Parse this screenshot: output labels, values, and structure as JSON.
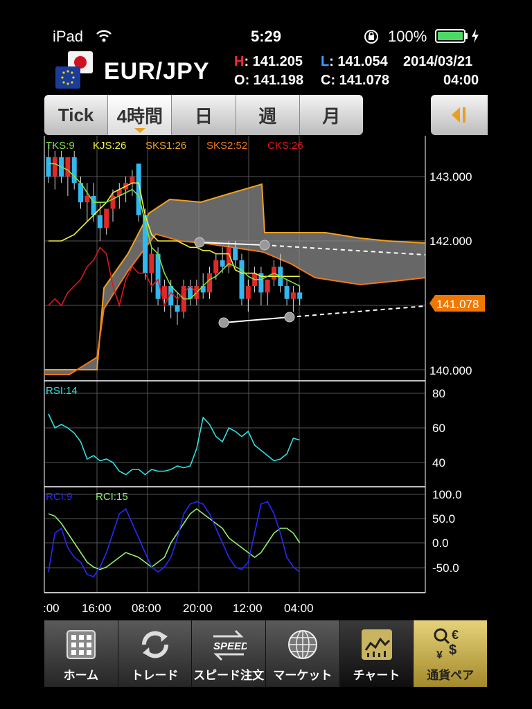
{
  "status_bar": {
    "device": "iPad",
    "time": "5:29",
    "battery": "100%"
  },
  "header": {
    "pair": "EUR/JPY",
    "high_label": "H",
    "high_value": ": 141.205",
    "low_label": "L",
    "low_value": ": 141.054",
    "open_label": "O",
    "open_value": ": 141.198",
    "close_label": "C",
    "close_value": ": 141.078",
    "date": "2014/03/21",
    "time": "04:00"
  },
  "tabs": [
    {
      "label": "Tick",
      "active": false
    },
    {
      "label": "4時間",
      "active": true
    },
    {
      "label": "日",
      "active": false
    },
    {
      "label": "週",
      "active": false
    },
    {
      "label": "月",
      "active": false
    }
  ],
  "indicators": {
    "tks": "TKS:9",
    "kjs": "KJS:26",
    "sks1": "SKS1:26",
    "sks2": "SKS2:52",
    "cks": "CKS:26",
    "rsi": "RSI:14",
    "rci9": "RCI:9",
    "rci15": "RCI:15"
  },
  "colors": {
    "tks": "#80e040",
    "kjs": "#f0f040",
    "sks1": "#f0a020",
    "sks2": "#f07818",
    "cks": "#e01818",
    "rsi": "#30e0e0",
    "rci9": "#2828ff",
    "rci15": "#90f070",
    "bull": "#e02828",
    "bear": "#30b8f0",
    "price_tag": "#f07800"
  },
  "price_axis": [
    "143.000",
    "142.000",
    "140.000"
  ],
  "current_price": "141.078",
  "rsi_axis": [
    "80",
    "60",
    "40"
  ],
  "rci_axis": [
    "100.0",
    "50.0",
    "0.0",
    "-50.0"
  ],
  "time_axis": [
    ":00",
    "16:00",
    "08:00",
    "20:00",
    "12:00",
    "04:00"
  ],
  "nav": [
    {
      "label": "ホーム",
      "icon": "grid-icon"
    },
    {
      "label": "トレード",
      "icon": "refresh-icon"
    },
    {
      "label": "スピード注文",
      "icon": "speed-icon"
    },
    {
      "label": "マーケット",
      "icon": "globe-icon"
    },
    {
      "label": "チャート",
      "icon": "chart-icon",
      "active": true
    },
    {
      "label": "通貨ペア",
      "icon": "currency-icon"
    }
  ],
  "chart_data": {
    "type": "candlestick",
    "ylim": [
      139.9,
      143.3
    ],
    "grid": true,
    "x_ticks": [
      ":00",
      "16:00",
      "08:00",
      "20:00",
      "12:00",
      "04:00"
    ],
    "candles": [
      [
        143.3,
        143.5,
        142.9,
        143.0
      ],
      [
        143.0,
        143.4,
        142.8,
        143.3
      ],
      [
        143.3,
        143.4,
        142.9,
        143.0
      ],
      [
        143.0,
        143.3,
        142.7,
        143.3
      ],
      [
        143.3,
        143.4,
        142.8,
        142.9
      ],
      [
        142.9,
        143.0,
        142.5,
        142.6
      ],
      [
        142.6,
        142.9,
        142.3,
        142.7
      ],
      [
        142.7,
        142.9,
        142.3,
        142.4
      ],
      [
        142.4,
        142.6,
        142.0,
        142.2
      ],
      [
        142.2,
        142.5,
        142.1,
        142.5
      ],
      [
        142.5,
        142.8,
        142.3,
        142.7
      ],
      [
        142.7,
        142.9,
        142.5,
        142.8
      ],
      [
        142.8,
        143.0,
        142.6,
        142.9
      ],
      [
        142.9,
        143.1,
        142.7,
        143.0
      ],
      [
        143.2,
        143.2,
        142.3,
        142.4
      ],
      [
        142.4,
        142.5,
        141.4,
        141.5
      ],
      [
        141.5,
        141.9,
        141.2,
        141.8
      ],
      [
        141.8,
        141.9,
        141.0,
        141.1
      ],
      [
        141.1,
        141.4,
        140.9,
        141.3
      ],
      [
        141.3,
        141.4,
        140.8,
        141.0
      ],
      [
        141.0,
        141.2,
        140.7,
        140.9
      ],
      [
        140.9,
        141.4,
        140.8,
        141.3
      ],
      [
        141.3,
        141.4,
        141.0,
        141.1
      ],
      [
        141.1,
        141.4,
        141.0,
        141.3
      ],
      [
        141.3,
        141.5,
        141.1,
        141.2
      ],
      [
        141.2,
        141.6,
        141.1,
        141.5
      ],
      [
        141.5,
        141.8,
        141.4,
        141.7
      ],
      [
        141.7,
        141.9,
        141.5,
        141.6
      ],
      [
        141.6,
        142.0,
        141.5,
        141.9
      ],
      [
        141.9,
        142.0,
        141.6,
        141.7
      ],
      [
        141.7,
        141.8,
        141.0,
        141.1
      ],
      [
        141.1,
        141.4,
        140.9,
        141.3
      ],
      [
        141.3,
        141.6,
        141.2,
        141.5
      ],
      [
        141.5,
        141.6,
        141.0,
        141.2
      ],
      [
        141.2,
        141.4,
        141.0,
        141.4
      ],
      [
        141.4,
        141.7,
        141.3,
        141.6
      ],
      [
        141.6,
        141.8,
        141.2,
        141.3
      ],
      [
        141.3,
        141.4,
        141.0,
        141.1
      ],
      [
        141.1,
        141.3,
        140.9,
        141.2
      ],
      [
        141.2,
        141.3,
        141.0,
        141.1
      ]
    ],
    "tks": [
      143.2,
      143.2,
      143.15,
      143.1,
      143.0,
      142.9,
      142.75,
      142.6,
      142.6,
      142.6,
      142.65,
      142.7,
      142.75,
      142.8,
      142.7,
      142.3,
      141.9,
      141.8,
      141.5,
      141.3,
      141.2,
      141.1,
      141.1,
      141.2,
      141.3,
      141.4,
      141.45,
      141.55,
      141.65,
      141.6,
      141.55,
      141.45,
      141.4,
      141.4,
      141.45,
      141.5,
      141.45,
      141.4,
      141.35,
      141.3
    ],
    "kjs": [
      142.0,
      142.0,
      142.0,
      142.05,
      142.1,
      142.2,
      142.3,
      142.4,
      142.5,
      142.6,
      142.75,
      142.8,
      142.85,
      142.9,
      142.9,
      142.4,
      142.1,
      142.0,
      142.0,
      142.0,
      142.0,
      141.95,
      141.9,
      141.9,
      141.85,
      141.85,
      141.8,
      141.8,
      141.8,
      141.55,
      141.5,
      141.5,
      141.5,
      141.45,
      141.45,
      141.45,
      141.45,
      141.45,
      141.45,
      141.45
    ],
    "cks": [
      141.0,
      141.1,
      141.0,
      141.2,
      141.3,
      141.4,
      141.6,
      141.7,
      141.9,
      141.8,
      141.3,
      141.0,
      141.4,
      141.6,
      141.5,
      141.5,
      141.3,
      141.4,
      141.0,
      141.2,
      141.1,
      141.2,
      141.3,
      141.2
    ],
    "rsi": [
      68,
      60,
      62,
      60,
      57,
      52,
      42,
      44,
      41,
      42,
      40,
      35,
      33,
      36,
      36,
      33,
      36,
      35,
      35,
      36,
      38,
      37,
      38,
      48,
      66,
      62,
      55,
      52,
      60,
      58,
      55,
      58,
      50,
      47,
      44,
      41,
      42,
      45,
      54,
      53
    ],
    "rci9": [
      -60,
      20,
      30,
      -10,
      -30,
      -40,
      -65,
      -70,
      -50,
      -20,
      20,
      60,
      70,
      40,
      10,
      -20,
      -50,
      -60,
      -50,
      -30,
      10,
      60,
      80,
      85,
      80,
      60,
      30,
      0,
      -30,
      -50,
      -55,
      -40,
      20,
      80,
      85,
      60,
      20,
      -30,
      -50,
      -60
    ],
    "rci15": [
      60,
      55,
      40,
      20,
      0,
      -20,
      -40,
      -50,
      -55,
      -50,
      -40,
      -30,
      -20,
      -25,
      -30,
      -40,
      -50,
      -40,
      -30,
      0,
      20,
      40,
      60,
      70,
      60,
      50,
      40,
      30,
      10,
      0,
      -10,
      -20,
      -30,
      -20,
      0,
      20,
      30,
      30,
      20,
      0
    ]
  }
}
